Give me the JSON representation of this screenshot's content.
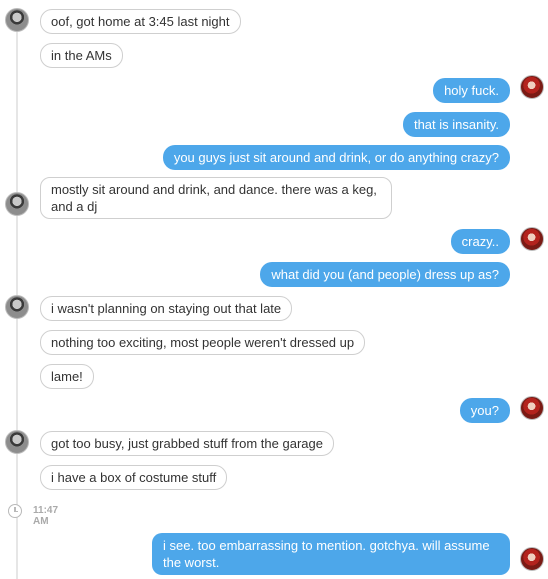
{
  "colors": {
    "outgoing_bubble": "#4da7ea",
    "incoming_border": "#cfcfcf",
    "background": "#ffffff",
    "timestamp": "#aaaaaa"
  },
  "messages": [
    {
      "from": "them",
      "text": "oof, got home at 3:45 last night",
      "avatar": true
    },
    {
      "from": "them",
      "text": "in the AMs",
      "avatar": false
    },
    {
      "from": "me",
      "text": "holy fuck.",
      "avatar": true
    },
    {
      "from": "me",
      "text": "that is insanity.",
      "avatar": false
    },
    {
      "from": "me",
      "text": "you guys just sit around and drink, or do anything crazy?",
      "avatar": false
    },
    {
      "from": "them",
      "text": "mostly sit around and drink, and dance. there was a keg, and a dj",
      "avatar": true
    },
    {
      "from": "me",
      "text": "crazy..",
      "avatar": true
    },
    {
      "from": "me",
      "text": "what did you (and people) dress up as?",
      "avatar": false
    },
    {
      "from": "them",
      "text": "i wasn't planning on staying out that late",
      "avatar": true
    },
    {
      "from": "them",
      "text": "nothing too exciting, most people weren't dressed up",
      "avatar": false
    },
    {
      "from": "them",
      "text": "lame!",
      "avatar": false
    },
    {
      "from": "me",
      "text": "you?",
      "avatar": true
    },
    {
      "from": "them",
      "text": "got too busy, just grabbed stuff from the garage",
      "avatar": true
    },
    {
      "from": "them",
      "text": "i have a box of costume stuff",
      "avatar": false
    },
    {
      "from": "me",
      "text": "i see. too embarrassing to mention. gotchya. will assume the worst.",
      "avatar": true
    }
  ],
  "timestamp": {
    "icon": "clock-icon",
    "label": "11:47 AM"
  }
}
